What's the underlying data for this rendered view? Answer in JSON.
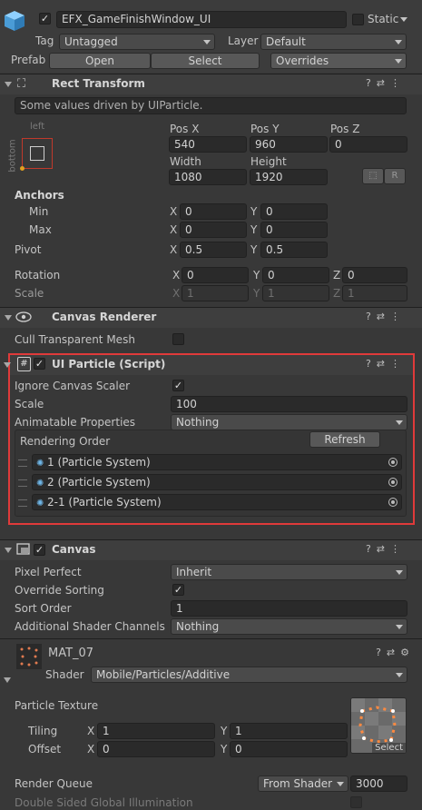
{
  "object": {
    "name": "EFX_GameFinishWindow_UI",
    "static_label": "Static",
    "tag_label": "Tag",
    "tag_value": "Untagged",
    "layer_label": "Layer",
    "layer_value": "Default",
    "prefab_label": "Prefab",
    "open_label": "Open",
    "select_label": "Select",
    "overrides_label": "Overrides"
  },
  "rect_transform": {
    "title": "Rect Transform",
    "info": "Some values driven by UIParticle.",
    "anchor_left": "left",
    "anchor_bottom": "bottom",
    "posx_label": "Pos X",
    "posy_label": "Pos Y",
    "posz_label": "Pos Z",
    "posx": "540",
    "posy": "960",
    "posz": "0",
    "width_label": "Width",
    "height_label": "Height",
    "width": "1080",
    "height": "1920",
    "r_label": "R",
    "anchors_label": "Anchors",
    "min_label": "Min",
    "max_label": "Max",
    "min_x": "0",
    "min_y": "0",
    "max_x": "0",
    "max_y": "0",
    "pivot_label": "Pivot",
    "pivot_x": "0.5",
    "pivot_y": "0.5",
    "rotation_label": "Rotation",
    "rot_x": "0",
    "rot_y": "0",
    "rot_z": "0",
    "scale_label": "Scale",
    "scale_x": "1",
    "scale_y": "1",
    "scale_z": "1",
    "x": "X",
    "y": "Y",
    "z": "Z"
  },
  "canvas_renderer": {
    "title": "Canvas Renderer",
    "cull_label": "Cull Transparent Mesh"
  },
  "ui_particle": {
    "title": "UI Particle (Script)",
    "ignore_label": "Ignore Canvas Scaler",
    "scale_label": "Scale",
    "scale_value": "100",
    "animatable_label": "Animatable Properties",
    "animatable_value": "Nothing",
    "rendering_order_label": "Rendering Order",
    "refresh_label": "Refresh",
    "items": [
      "1 (Particle System)",
      "2 (Particle System)",
      "2-1 (Particle System)"
    ]
  },
  "canvas": {
    "title": "Canvas",
    "pixel_perfect_label": "Pixel Perfect",
    "pixel_perfect_value": "Inherit",
    "override_sorting_label": "Override Sorting",
    "sort_order_label": "Sort Order",
    "sort_order_value": "1",
    "shader_channels_label": "Additional Shader Channels",
    "shader_channels_value": "Nothing"
  },
  "material": {
    "name": "MAT_07",
    "shader_label": "Shader",
    "shader_value": "Mobile/Particles/Additive",
    "texture_label": "Particle Texture",
    "tiling_label": "Tiling",
    "offset_label": "Offset",
    "tiling_x": "1",
    "tiling_y": "1",
    "offset_x": "0",
    "offset_y": "0",
    "select_label": "Select",
    "render_queue_label": "Render Queue",
    "render_queue_mode": "From Shader",
    "render_queue_value": "3000",
    "double_sided_label": "Double Sided Global Illumination"
  },
  "colors": {
    "highlight": "#e03a3a",
    "background": "#383838",
    "accent": "#6fb7e8"
  }
}
